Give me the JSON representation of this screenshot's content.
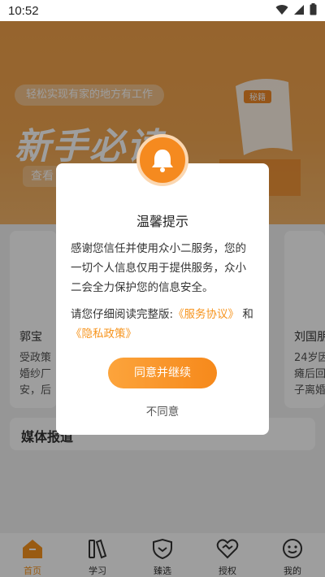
{
  "status_bar": {
    "time": "10:52"
  },
  "banner": {
    "slogan": "轻松实现有家的地方有工作",
    "title": "新手必读",
    "cta": "查看",
    "deco_label": "秘籍"
  },
  "cards": {
    "left": {
      "name": "郭宝",
      "lines": [
        "受政策",
        "婚纱厂",
        "安，后"
      ]
    },
    "right": {
      "name": "刘国朋",
      "lines": [
        "24岁因",
        "瘫后回",
        "子离婚"
      ]
    }
  },
  "media_section": {
    "title": "媒体报道"
  },
  "dialog": {
    "title": "温馨提示",
    "body": "感谢您信任并使用众小二服务，您的一切个人信息仅用于提供服务，众小二会全力保护您的信息安全。",
    "links_prefix": "请您仔细阅读完整版:",
    "service_link": "《服务协议》",
    "and_text": "和",
    "privacy_link": "《隐私政策》",
    "agree_label": "同意并继续",
    "disagree_label": "不同意"
  },
  "bottom_nav": {
    "items": [
      {
        "label": "首页",
        "icon": "home-icon",
        "active": true
      },
      {
        "label": "学习",
        "icon": "books-icon",
        "active": false
      },
      {
        "label": "臻选",
        "icon": "heart-shield-icon",
        "active": false
      },
      {
        "label": "授权",
        "icon": "handshake-heart-icon",
        "active": false
      },
      {
        "label": "我的",
        "icon": "smiley-face-icon",
        "active": false
      }
    ]
  },
  "colors": {
    "accent": "#f7941d",
    "banner": "#f3a24a"
  }
}
